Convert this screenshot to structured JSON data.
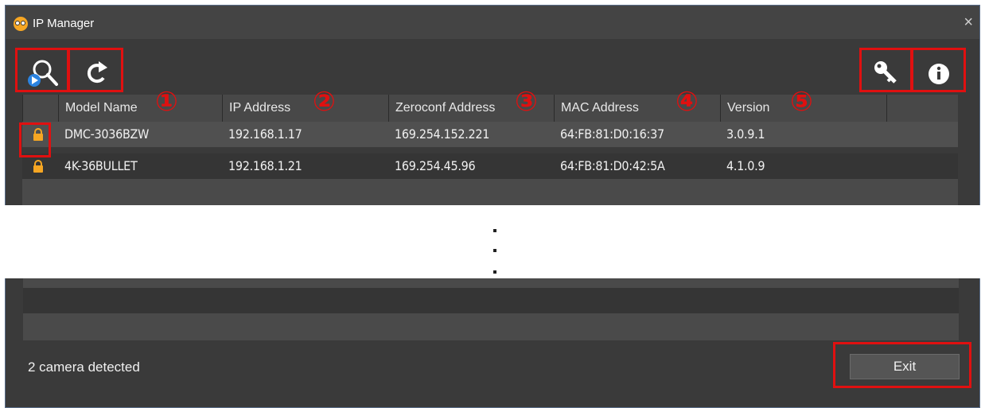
{
  "window": {
    "title": "IP Manager",
    "close_symbol": "×"
  },
  "toolbar": {
    "left_buttons": [
      {
        "icon": "search-camera-icon"
      },
      {
        "icon": "refresh-icon"
      }
    ],
    "right_buttons": [
      {
        "icon": "key-icon"
      },
      {
        "icon": "info-icon"
      }
    ]
  },
  "table": {
    "columns": [
      "Model Name",
      "IP Address",
      "Zeroconf Address",
      "MAC Address",
      "Version"
    ],
    "rows": [
      {
        "model": "DMC-3036BZW",
        "ip": "192.168.1.17",
        "zeroconf": "169.254.152.221",
        "mac": "64:FB:81:D0:16:37",
        "version": "3.0.9.1",
        "lock_icon": "lock-icon"
      },
      {
        "model": "4K-36BULLET",
        "ip": "192.168.1.21",
        "zeroconf": "169.254.45.96",
        "mac": "64:FB:81:D0:42:5A",
        "version": "4.1.0.9",
        "lock_icon": "lock-icon"
      }
    ]
  },
  "annotations": [
    "①",
    "②",
    "③",
    "④",
    "⑤"
  ],
  "status": {
    "text": "2 camera detected"
  },
  "footer": {
    "exit_label": "Exit"
  },
  "colors": {
    "highlight": "#e01010",
    "window_bg": "#3a3a3a",
    "lock": "#f6a623"
  }
}
